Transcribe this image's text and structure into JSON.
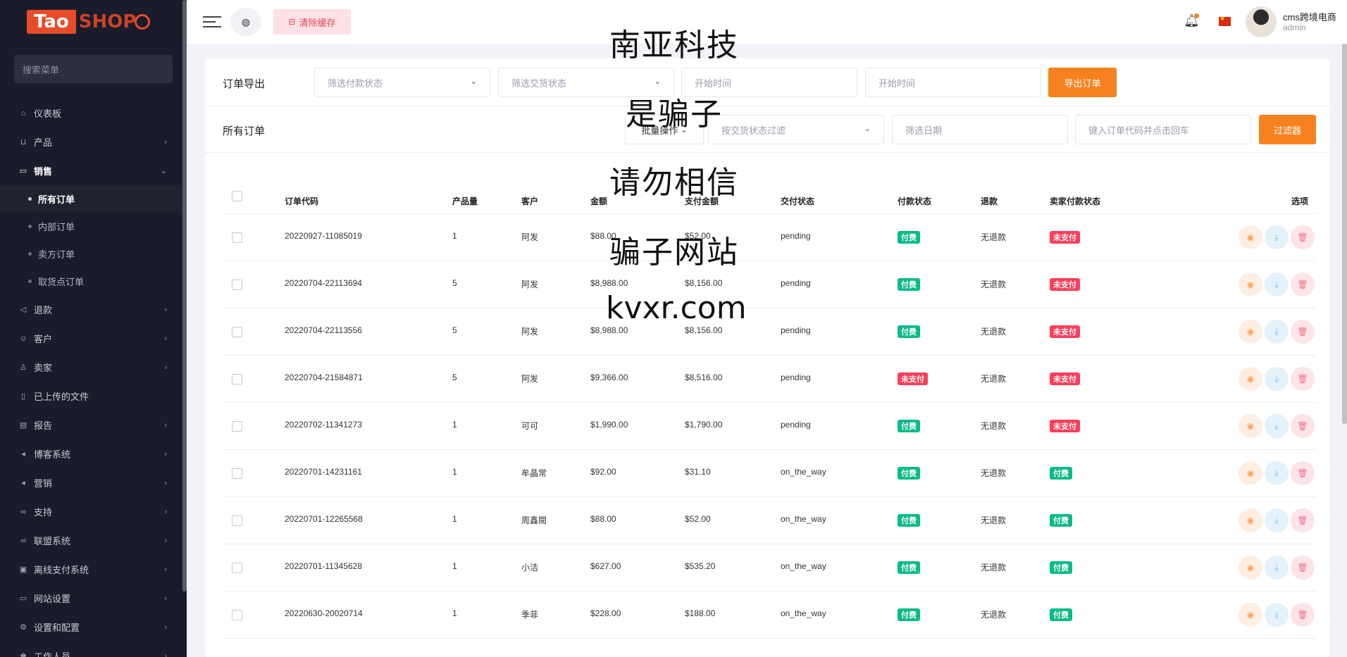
{
  "brand": {
    "logo_left": "Tao",
    "logo_right": "SHOP"
  },
  "sidebar": {
    "search_placeholder": "搜索菜单",
    "items": [
      {
        "label": "仪表板",
        "icon": "home-icon"
      },
      {
        "label": "产品",
        "icon": "cart-icon"
      },
      {
        "label": "销售",
        "icon": "card-icon"
      },
      {
        "label": "退款",
        "icon": "backward-icon"
      },
      {
        "label": "客户",
        "icon": "users-icon"
      },
      {
        "label": "卖家",
        "icon": "user-icon"
      },
      {
        "label": "已上传的文件",
        "icon": "file-icon"
      },
      {
        "label": "报告",
        "icon": "report-icon"
      },
      {
        "label": "博客系统",
        "icon": "megaphone-icon"
      },
      {
        "label": "营销",
        "icon": "megaphone-icon"
      },
      {
        "label": "支持",
        "icon": "link-icon"
      },
      {
        "label": "联盟系统",
        "icon": "link-icon"
      },
      {
        "label": "离线支付系统",
        "icon": "money-icon"
      },
      {
        "label": "网站设置",
        "icon": "monitor-icon"
      },
      {
        "label": "设置和配置",
        "icon": "gear-icon"
      },
      {
        "label": "工作人员",
        "icon": "staff-icon"
      }
    ],
    "sales_sub": [
      "所有订单",
      "内部订单",
      "卖方订单",
      "取货点订单"
    ]
  },
  "topbar": {
    "clear_cache": "清除缓存",
    "user_name": "cms跨境电商",
    "user_role": "admin"
  },
  "export": {
    "title": "订单导出",
    "payment_filter": "筛选付款状态",
    "delivery_filter": "筛选交货状态",
    "start_time_1": "开始时间",
    "start_time_2": "开始时间",
    "button": "导出订单"
  },
  "orders": {
    "title": "所有订单",
    "bulk": "批量操作",
    "delivery_filter": "按交货状态过滤",
    "date_filter": "筛选日期",
    "code_search": "键入订单代码并点击回车",
    "filter_button": "过滤器"
  },
  "table": {
    "headers": [
      "订单代码",
      "产品量",
      "客户",
      "金额",
      "支付金额",
      "交付状态",
      "付款状态",
      "退款",
      "卖家付款状态",
      "选项"
    ],
    "rows": [
      {
        "code": "20220927-11085019",
        "qty": "1",
        "customer": "阿发",
        "amount": "$88.00",
        "paid": "$52.00",
        "delivery": "pending",
        "payment": "付费",
        "payment_color": "green",
        "refund": "无退款",
        "seller": "未支付",
        "seller_color": "red"
      },
      {
        "code": "20220704-22113694",
        "qty": "5",
        "customer": "阿发",
        "amount": "$8,988.00",
        "paid": "$8,156.00",
        "delivery": "pending",
        "payment": "付费",
        "payment_color": "green",
        "refund": "无退款",
        "seller": "未支付",
        "seller_color": "red"
      },
      {
        "code": "20220704-22113556",
        "qty": "5",
        "customer": "阿发",
        "amount": "$8,988.00",
        "paid": "$8,156.00",
        "delivery": "pending",
        "payment": "付费",
        "payment_color": "green",
        "refund": "无退款",
        "seller": "未支付",
        "seller_color": "red"
      },
      {
        "code": "20220704-21584871",
        "qty": "5",
        "customer": "阿发",
        "amount": "$9,366.00",
        "paid": "$8,516.00",
        "delivery": "pending",
        "payment": "未支付",
        "payment_color": "red",
        "refund": "无退款",
        "seller": "未支付",
        "seller_color": "red"
      },
      {
        "code": "20220702-11341273",
        "qty": "1",
        "customer": "可可",
        "amount": "$1,990.00",
        "paid": "$1,790.00",
        "delivery": "pending",
        "payment": "付费",
        "payment_color": "green",
        "refund": "无退款",
        "seller": "未支付",
        "seller_color": "red"
      },
      {
        "code": "20220701-14231161",
        "qty": "1",
        "customer": "牟晶常",
        "amount": "$92.00",
        "paid": "$31.10",
        "delivery": "on_the_way",
        "payment": "付费",
        "payment_color": "green",
        "refund": "无退款",
        "seller": "付费",
        "seller_color": "green"
      },
      {
        "code": "20220701-12265568",
        "qty": "1",
        "customer": "周鑫閱",
        "amount": "$88.00",
        "paid": "$52.00",
        "delivery": "on_the_way",
        "payment": "付费",
        "payment_color": "green",
        "refund": "无退款",
        "seller": "付费",
        "seller_color": "green"
      },
      {
        "code": "20220701-11345628",
        "qty": "1",
        "customer": "小洁",
        "amount": "$627.00",
        "paid": "$535.20",
        "delivery": "on_the_way",
        "payment": "付费",
        "payment_color": "green",
        "refund": "无退款",
        "seller": "付费",
        "seller_color": "green"
      },
      {
        "code": "20220630-20020714",
        "qty": "1",
        "customer": "季菲",
        "amount": "$228.00",
        "paid": "$188.00",
        "delivery": "on_the_way",
        "payment": "付费",
        "payment_color": "green",
        "refund": "无退款",
        "seller": "付费",
        "seller_color": "green"
      }
    ]
  },
  "overlay": [
    "南亚科技",
    "是骗子",
    "请勿相信",
    "骗子网站",
    "kvxr.com"
  ],
  "colors": {
    "accent": "#f6821f",
    "sidebar_bg": "#1a1c2b",
    "paid": "#0abb87",
    "unpaid": "#fd3e5b"
  }
}
